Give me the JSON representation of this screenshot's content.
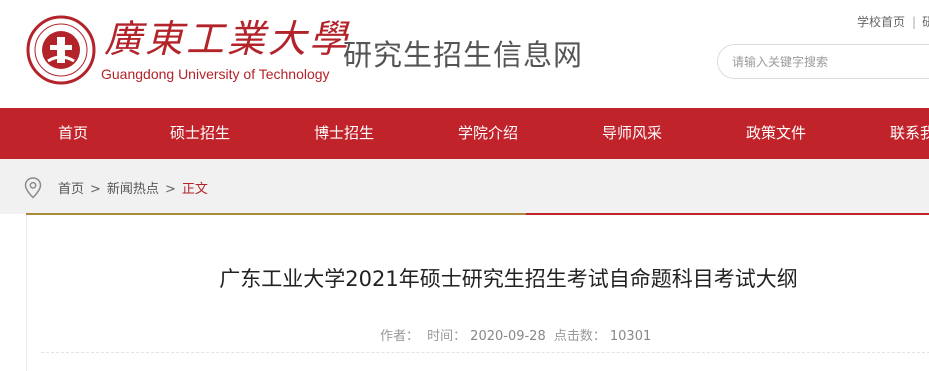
{
  "header": {
    "logo_cn": "廣東工業大學",
    "logo_en": "Guangdong University of Technology",
    "site_title": "研究生招生信息网",
    "toplinks": [
      "学校首页",
      "研"
    ],
    "search": {
      "placeholder": "请输入关键字搜索"
    },
    "brand_color": "#c1232b"
  },
  "nav": {
    "items": [
      "首页",
      "硕士招生",
      "博士招生",
      "学院介绍",
      "导师风采",
      "政策文件",
      "联系我"
    ]
  },
  "breadcrumb": {
    "items": [
      "首页",
      "新闻热点"
    ],
    "current": "正文",
    "separator": ">"
  },
  "article": {
    "title": "广东工业大学2021年硕士研究生招生考试自命题科目考试大纲",
    "author_label": "作者：",
    "time_label": "时间：",
    "time_value": "2020-09-28",
    "clicks_label": "点击数：",
    "clicks_value": "10301"
  },
  "icons": {
    "logo": "university-seal-icon",
    "location": "location-pin-icon"
  }
}
